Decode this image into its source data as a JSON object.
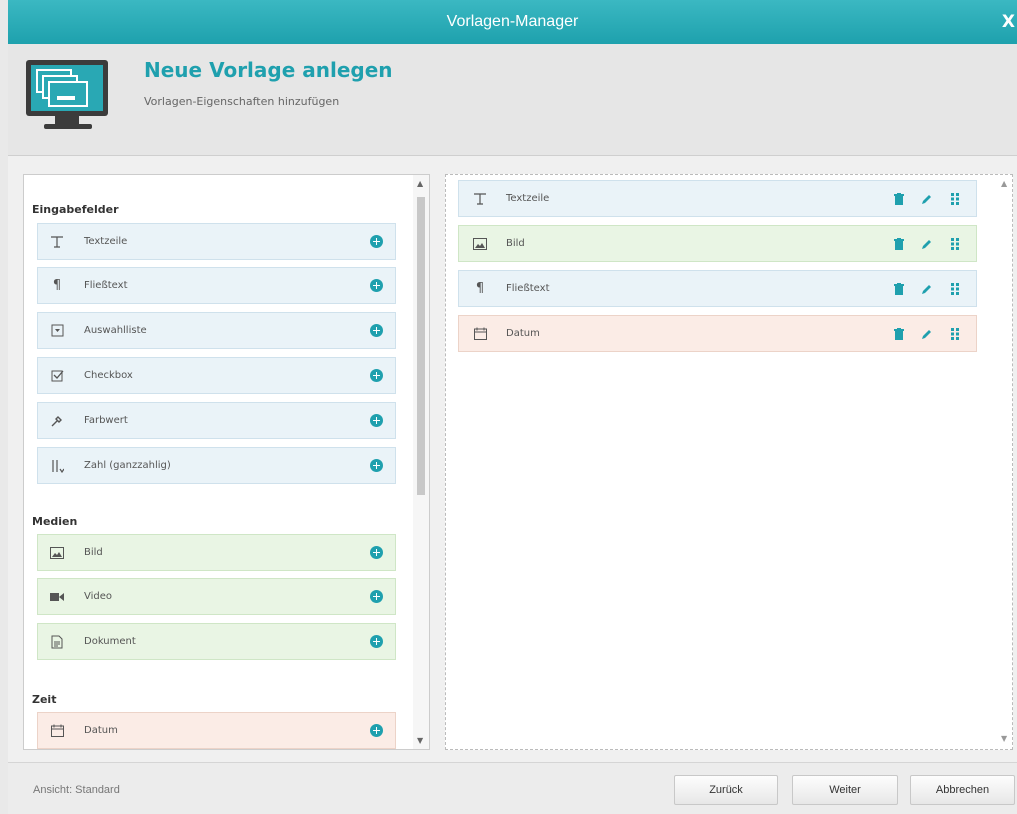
{
  "window": {
    "title": "Vorlagen-Manager",
    "close_glyph": "X"
  },
  "header": {
    "title": "Neue Vorlage anlegen",
    "subtitle": "Vorlagen-Eigenschaften hinzufügen"
  },
  "palette": {
    "sections": [
      {
        "title": "Eingabefelder",
        "items": [
          {
            "label": "Textzeile",
            "icon": "text-line-icon"
          },
          {
            "label": "Fließtext",
            "icon": "paragraph-icon"
          },
          {
            "label": "Auswahlliste",
            "icon": "select-list-icon"
          },
          {
            "label": "Checkbox",
            "icon": "checkbox-icon"
          },
          {
            "label": "Farbwert",
            "icon": "color-picker-icon"
          },
          {
            "label": "Zahl (ganzzahlig)",
            "icon": "number-icon"
          }
        ]
      },
      {
        "title": "Medien",
        "items": [
          {
            "label": "Bild",
            "icon": "image-icon"
          },
          {
            "label": "Video",
            "icon": "video-icon"
          },
          {
            "label": "Dokument",
            "icon": "document-icon"
          }
        ]
      },
      {
        "title": "Zeit",
        "items": [
          {
            "label": "Datum",
            "icon": "calendar-icon"
          }
        ]
      }
    ]
  },
  "template_fields": [
    {
      "label": "Textzeile",
      "icon": "text-line-icon"
    },
    {
      "label": "Bild",
      "icon": "image-icon"
    },
    {
      "label": "Fließtext",
      "icon": "paragraph-icon"
    },
    {
      "label": "Datum",
      "icon": "calendar-icon"
    }
  ],
  "footer": {
    "status": "Ansicht: Standard",
    "back_label": "Zurück",
    "next_label": "Weiter",
    "cancel_label": "Abbrechen"
  },
  "colors": {
    "accent": "#1fa0ae",
    "input_bg": "#eaf3f8",
    "media_bg": "#e9f5e4",
    "time_bg": "#fbece6"
  }
}
